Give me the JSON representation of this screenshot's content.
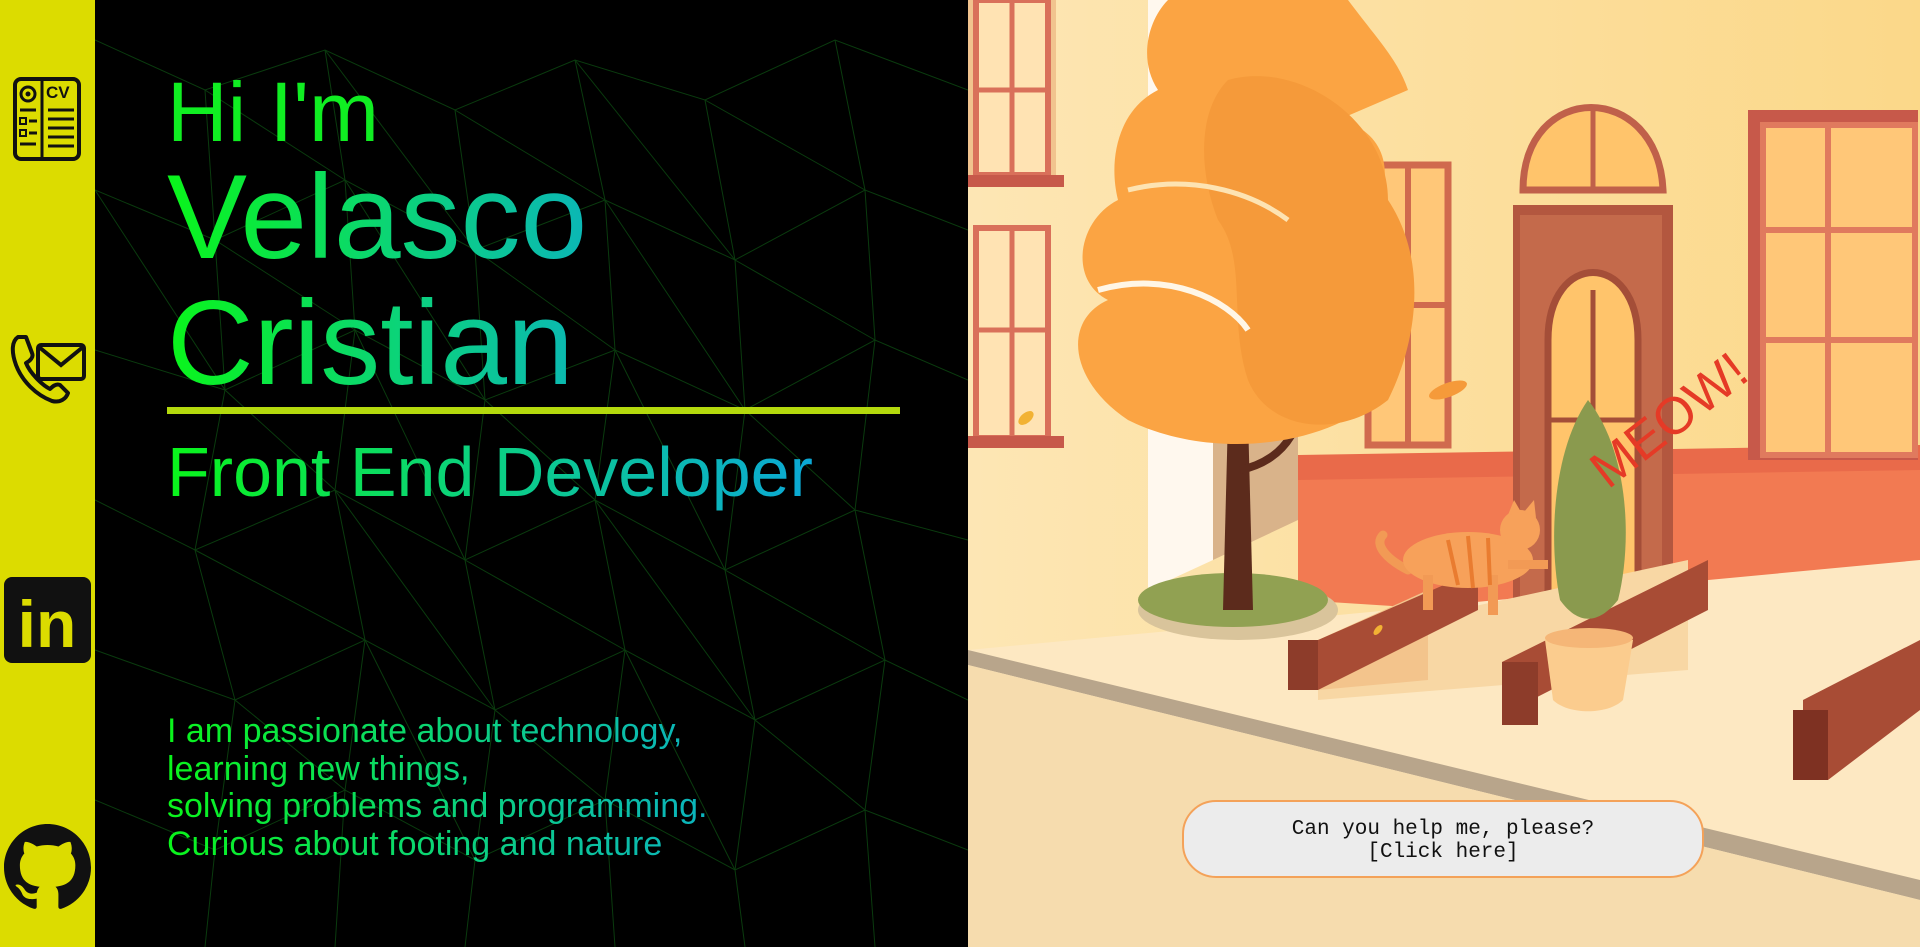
{
  "sidebar": {
    "items": [
      {
        "name": "cv-icon",
        "label": "CV"
      },
      {
        "name": "mail-phone-icon"
      },
      {
        "name": "linkedin-icon",
        "label": "in"
      },
      {
        "name": "github-icon"
      }
    ],
    "background": "#dcdc00"
  },
  "intro": {
    "greeting": "Hi I'm",
    "first_name": "Velasco",
    "last_name": "Cristian",
    "role": "Front End Developer",
    "about_lines": [
      "I am passionate about technology,",
      "learning new things,",
      "solving problems and programming.",
      "Curious about footing and nature"
    ],
    "accent_colors": {
      "start": "#0af51a",
      "end": "#0ba8d6",
      "underline": "#b4d90d"
    }
  },
  "scene": {
    "meow_text": "MEOW!",
    "help_button": {
      "line1": "Can you help me, please?",
      "line2": "[Click here]"
    }
  }
}
